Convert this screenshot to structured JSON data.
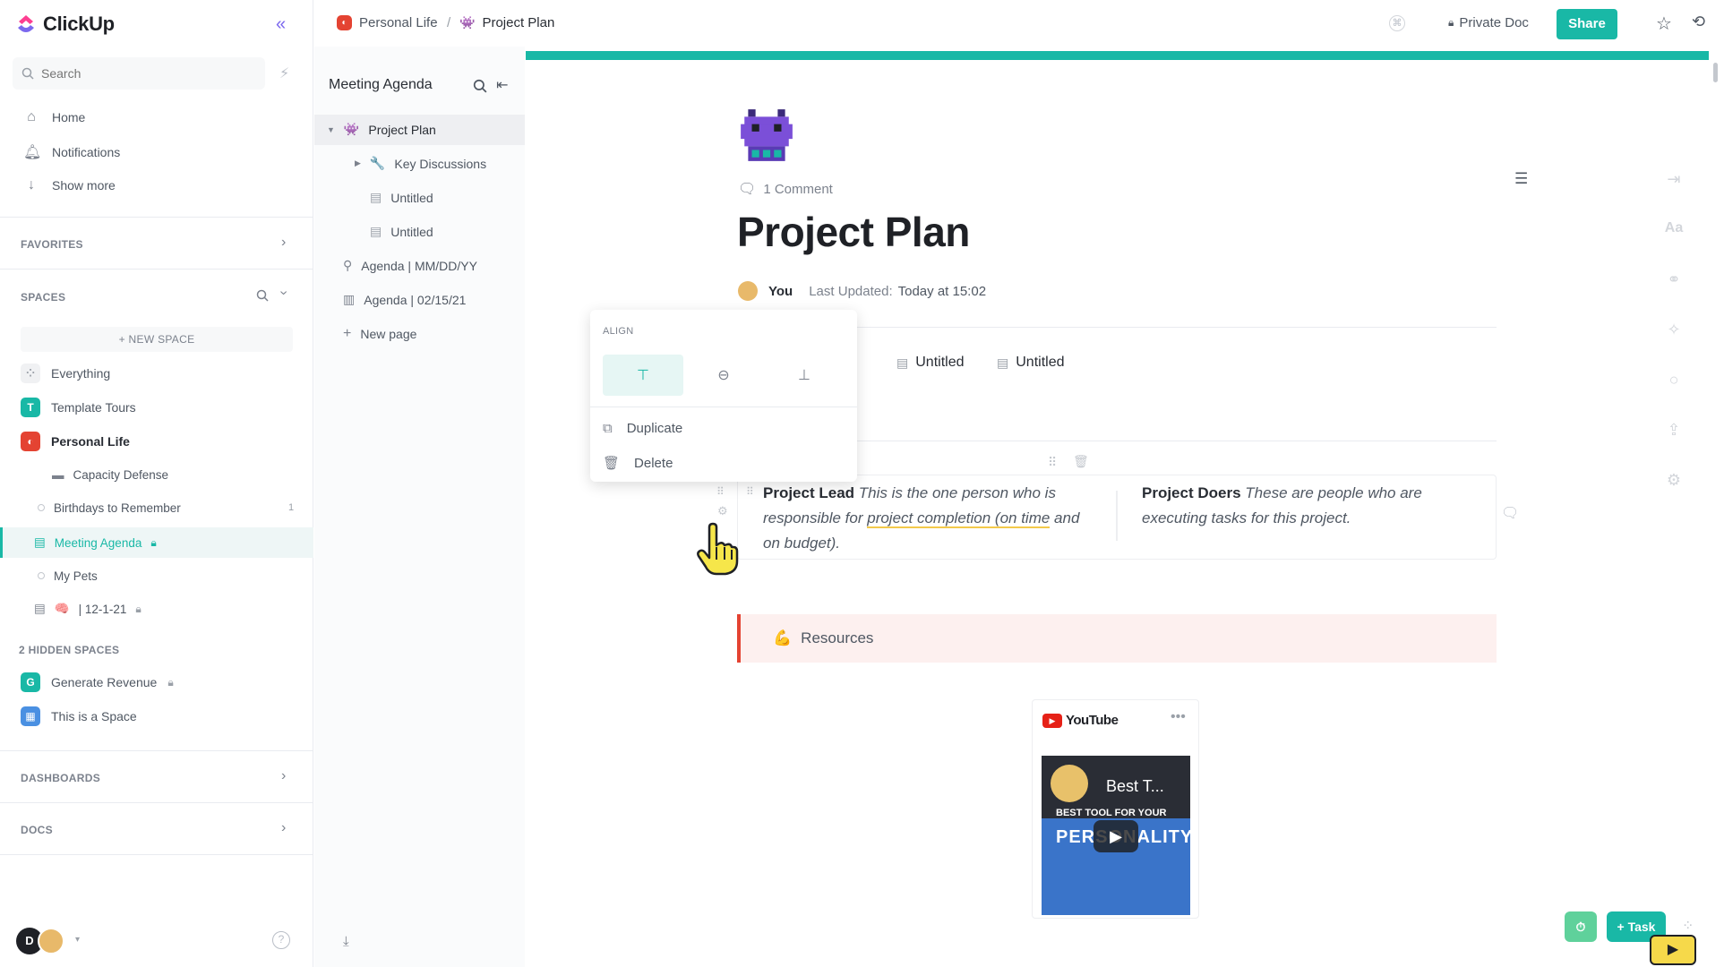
{
  "app": {
    "name": "ClickUp"
  },
  "sidebar": {
    "search_placeholder": "Search",
    "nav": [
      {
        "label": "Home",
        "icon": "home-icon"
      },
      {
        "label": "Notifications",
        "icon": "bell-icon"
      },
      {
        "label": "Show more",
        "icon": "arrow-down-icon"
      }
    ],
    "favorites_label": "FAVORITES",
    "spaces_label": "SPACES",
    "new_space_label": "+ NEW SPACE",
    "spaces": [
      {
        "label": "Everything",
        "badge": ""
      },
      {
        "label": "Template Tours",
        "badge": "T",
        "color": "#19b8a6"
      },
      {
        "label": "Personal Life",
        "badge": "",
        "color": "#e44332"
      }
    ],
    "personal_children": [
      {
        "label": "Capacity Defense"
      },
      {
        "label": "Birthdays to Remember",
        "count": "1"
      },
      {
        "label": "Meeting Agenda"
      },
      {
        "label": "My Pets"
      },
      {
        "label": "| 12-1-21"
      }
    ],
    "hidden_spaces_label": "2 HIDDEN SPACES",
    "hidden_spaces": [
      {
        "label": "Generate Revenue",
        "badge": "G",
        "color": "#19b8a6"
      },
      {
        "label": "This is a Space",
        "color": "#4a90e2"
      }
    ],
    "dashboards_label": "DASHBOARDS",
    "docs_label": "DOCS",
    "user_initial": "D"
  },
  "tree": {
    "title": "Meeting Agenda",
    "items": [
      {
        "label": "Project Plan"
      },
      {
        "label": "Key Discussions"
      },
      {
        "label": "Untitled"
      },
      {
        "label": "Untitled"
      },
      {
        "label": "Agenda | MM/DD/YY"
      },
      {
        "label": "Agenda | 02/15/21"
      },
      {
        "label": "New page"
      }
    ]
  },
  "topbar": {
    "crumb_space": "Personal Life",
    "crumb_sep": "/",
    "crumb_doc": "Project Plan",
    "private_label": "Private Doc",
    "share_label": "Share"
  },
  "doc": {
    "comment_count": "1 Comment",
    "title": "Project Plan",
    "author": "You",
    "updated_label": "Last Updated:",
    "updated_value": "Today at 15:02",
    "subpages": [
      "ons",
      "Untitled",
      "Untitled"
    ],
    "col1_bold": "Project Lead",
    "col1_text_a": "This is the one person who is responsible for ",
    "col1_text_u": "project completion (on time",
    "col1_text_b": " and on budget).",
    "col2_bold": "Project Doers",
    "col2_text": "These are people who are executing tasks for this project.",
    "resources_label": "Resources",
    "youtube_label": "YouTube",
    "video_title": "Best T...",
    "video_caption_1": "BEST TOOL FOR YOUR",
    "video_caption_2": "PERSONALITY"
  },
  "popup": {
    "align_label": "ALIGN",
    "duplicate_label": "Duplicate",
    "delete_label": "Delete"
  },
  "fab": {
    "task_label": "+ Task"
  }
}
